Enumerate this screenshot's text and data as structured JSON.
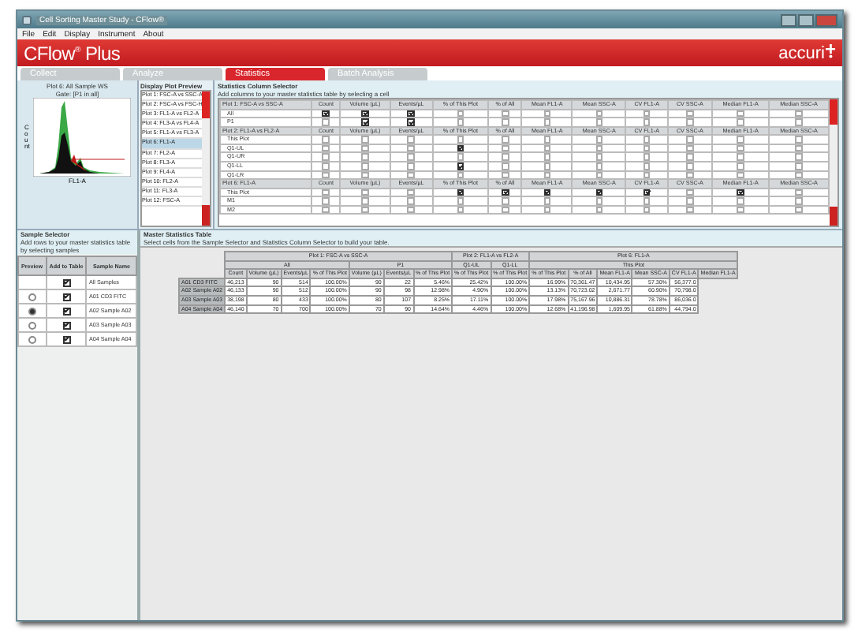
{
  "window": {
    "title": "Cell Sorting Master Study - CFlow®"
  },
  "menu": [
    "File",
    "Edit",
    "Display",
    "Instrument",
    "About"
  ],
  "brand": {
    "product": "CFlow$^{®}$ Plus",
    "company": "accuri"
  },
  "tabs": [
    {
      "label": "Collect",
      "selected": false
    },
    {
      "label": "Analyze",
      "selected": false
    },
    {
      "label": "Statistics",
      "selected": true
    },
    {
      "label": "Batch Analysis",
      "selected": false
    }
  ],
  "plot": {
    "title": "Plot 6: All Sample WS",
    "subtitle": "Gate: [P1 in all]",
    "ylabel": "Count",
    "xlabel": "FL1-A"
  },
  "plot_preview": {
    "title": "Display Plot Preview",
    "items": [
      {
        "label": "Plot 1: FSC-A vs SSC-A",
        "selected": false
      },
      {
        "label": "Plot 2: FSC-A vs FSC-H",
        "selected": false
      },
      {
        "label": "Plot 3: FL1-A vs FL2-A",
        "selected": false
      },
      {
        "label": "Plot 4: FL3-A vs FL4-A",
        "selected": false
      },
      {
        "label": "Plot 5: FL1-A vs FL3-A",
        "selected": false
      },
      {
        "label": "Plot 6: FL1-A",
        "selected": true
      },
      {
        "label": "Plot 7: FL2-A",
        "selected": false
      },
      {
        "label": "Plot 8: FL3-A",
        "selected": false
      },
      {
        "label": "Plot 9: FL4-A",
        "selected": false
      },
      {
        "label": "Plot 10: FL2-A",
        "selected": false
      },
      {
        "label": "Plot 11: FL3-A",
        "selected": false
      },
      {
        "label": "Plot 12: FSC-A",
        "selected": false
      }
    ]
  },
  "stats_selector": {
    "title": "Statistics Column Selector",
    "hint": "Add columns to your master statistics table by selecting a cell",
    "blocks": [
      {
        "label": "Plot 1: FSC-A vs SSC-A",
        "columns": [
          "Count",
          "Volume (µL)",
          "Events/µL",
          "% of This Plot",
          "% of All",
          "Mean FL1-A",
          "Mean SSC-A",
          "CV FL1-A",
          "CV SSC-A",
          "Median FL1-A",
          "Median SSC-A"
        ],
        "rows": [
          {
            "label": "All",
            "checks": [
              true,
              true,
              true,
              false,
              false,
              false,
              false,
              false,
              false,
              false,
              false
            ]
          },
          {
            "label": "P1",
            "checks": [
              false,
              true,
              true,
              false,
              false,
              false,
              false,
              false,
              false,
              false,
              false
            ]
          }
        ]
      },
      {
        "label": "Plot 2: FL1-A vs FL2-A",
        "columns": [
          "Count",
          "Volume (µL)",
          "Events/µL",
          "% of This Plot",
          "% of All",
          "Mean FL1-A",
          "Mean SSC-A",
          "CV FL1-A",
          "CV SSC-A",
          "Median FL1-A",
          "Median SSC-A"
        ],
        "rows": [
          {
            "label": "This Plot",
            "checks": [
              false,
              false,
              false,
              false,
              false,
              false,
              false,
              false,
              false,
              false,
              false
            ]
          },
          {
            "label": "Q1-UL",
            "checks": [
              false,
              false,
              false,
              true,
              false,
              false,
              false,
              false,
              false,
              false,
              false
            ]
          },
          {
            "label": "Q1-UR",
            "checks": [
              false,
              false,
              false,
              false,
              false,
              false,
              false,
              false,
              false,
              false,
              false
            ]
          },
          {
            "label": "Q1-LL",
            "checks": [
              false,
              false,
              false,
              true,
              false,
              false,
              false,
              false,
              false,
              false,
              false
            ]
          },
          {
            "label": "Q1-LR",
            "checks": [
              false,
              false,
              false,
              false,
              false,
              false,
              false,
              false,
              false,
              false,
              false
            ]
          }
        ]
      },
      {
        "label": "Plot 6: FL1-A",
        "columns": [
          "Count",
          "Volume (µL)",
          "Events/µL",
          "% of This Plot",
          "% of All",
          "Mean FL1-A",
          "Mean SSC-A",
          "CV FL1-A",
          "CV SSC-A",
          "Median FL1-A",
          "Median SSC-A"
        ],
        "rows": [
          {
            "label": "This Plot",
            "checks": [
              false,
              false,
              false,
              true,
              true,
              true,
              true,
              true,
              false,
              true,
              false
            ]
          },
          {
            "label": "M1",
            "checks": [
              false,
              false,
              false,
              false,
              false,
              false,
              false,
              false,
              false,
              false,
              false
            ]
          },
          {
            "label": "M2",
            "checks": [
              false,
              false,
              false,
              false,
              false,
              false,
              false,
              false,
              false,
              false,
              false
            ]
          }
        ]
      }
    ]
  },
  "sample_selector": {
    "title": "Sample Selector",
    "hint": "Add rows to your master statistics table by selecting samples",
    "columns": [
      "Preview",
      "Add to Table",
      "Sample Name"
    ],
    "rows": [
      {
        "name": "All Samples",
        "added": true
      },
      {
        "name": "A01 CD3 FITC",
        "preview_selected": false,
        "added": true
      },
      {
        "name": "A02 Sample A02",
        "preview_selected": true,
        "added": true
      },
      {
        "name": "A03 Sample A03",
        "preview_selected": false,
        "added": true
      },
      {
        "name": "A04 Sample A04",
        "preview_selected": false,
        "added": true
      }
    ]
  },
  "master_table": {
    "title": "Master Statistics Table",
    "hint": "Select cells from the Sample Selector and Statistics Column Selector to build your table.",
    "groups": [
      {
        "label": "Plot 1: FSC-A vs SSC-A",
        "subgroups": [
          {
            "label": "All",
            "columns": [
              "Count",
              "Volume (µL)",
              "Events/µL",
              "% of This Plot"
            ]
          },
          {
            "label": "P1",
            "columns": [
              "Volume (µL)",
              "Events/µL",
              "% of This Plot"
            ]
          }
        ]
      },
      {
        "label": "Plot 2: FL1-A vs FL2-A",
        "subgroups": [
          {
            "label": "Q1-UL",
            "columns": [
              "% of This Plot"
            ]
          },
          {
            "label": "Q1-LL",
            "columns": [
              "% of This Plot"
            ]
          }
        ]
      },
      {
        "label": "Plot 6: FL1-A",
        "subgroups": [
          {
            "label": "This Plot",
            "columns": [
              "% of This Plot",
              "% of All",
              "Mean FL1-A",
              "Mean SSC-A",
              "CV FL1-A",
              "Median FL1-A"
            ]
          }
        ]
      }
    ],
    "rows": [
      {
        "name": "A01 CD3 FITC",
        "cells": [
          "46,213",
          "90",
          "514",
          "100.00%",
          "90",
          "22",
          "5.46%",
          "25.42%",
          "100.00%",
          "16.99%",
          "70,361.47",
          "10,434.95",
          "57.30%",
          "56,377.0"
        ]
      },
      {
        "name": "A02 Sample A02",
        "cells": [
          "46,133",
          "90",
          "512",
          "100.00%",
          "90",
          "98",
          "12.98%",
          "4.90%",
          "100.00%",
          "13.13%",
          "70,723.02",
          "2,671.77",
          "60.90%",
          "70,798.0"
        ]
      },
      {
        "name": "A03 Sample A03",
        "cells": [
          "38,198",
          "80",
          "433",
          "100.00%",
          "80",
          "107",
          "8.25%",
          "17.11%",
          "100.00%",
          "17.98%",
          "75,167.96",
          "10,886.31",
          "78.78%",
          "86,036.0"
        ]
      },
      {
        "name": "A04 Sample A04",
        "cells": [
          "46,140",
          "70",
          "700",
          "100.00%",
          "70",
          "90",
          "14.64%",
          "4.46%",
          "100.00%",
          "12.68%",
          "41,196.98",
          "1,609.95",
          "61.88%",
          "44,794.0"
        ]
      }
    ]
  }
}
